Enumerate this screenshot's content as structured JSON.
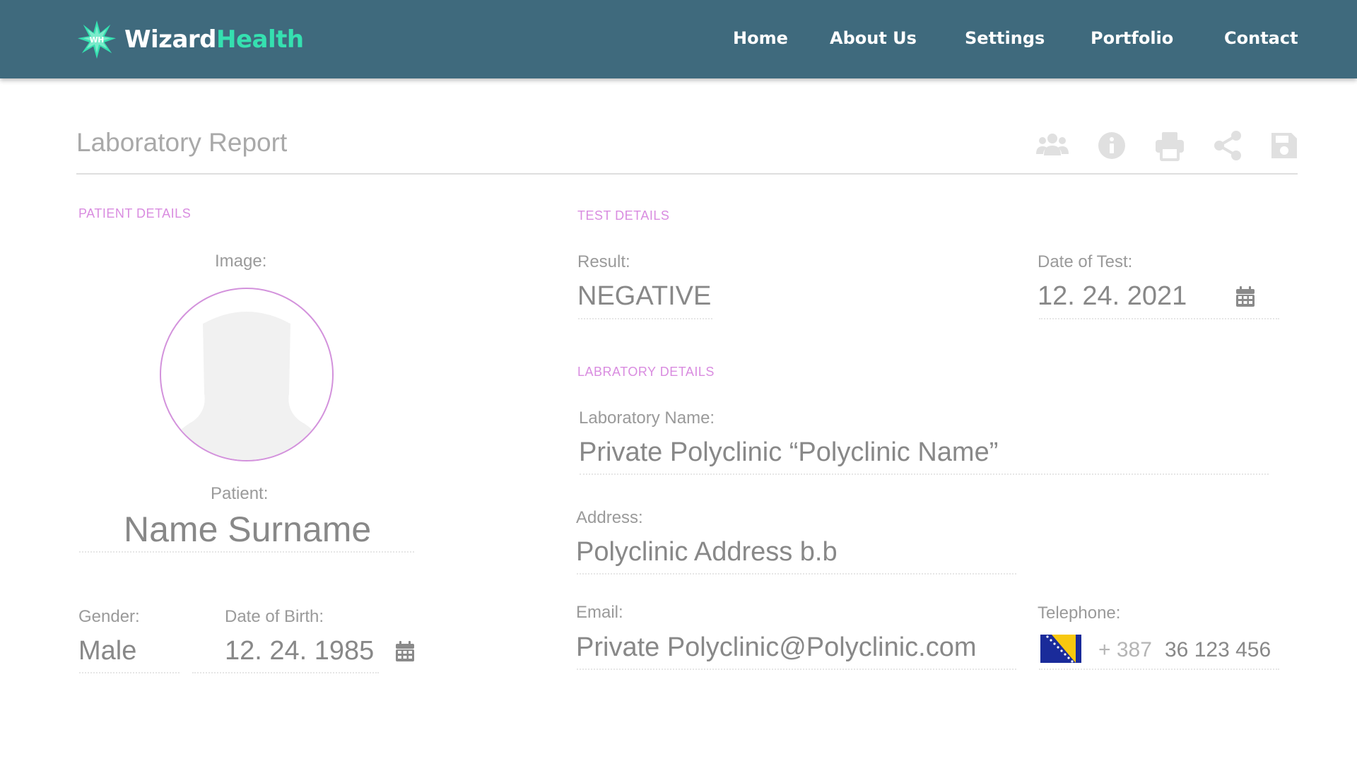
{
  "header": {
    "logo": {
      "word1": "Wizard",
      "word2": "Health",
      "mark_text": "WH",
      "accent_color": "#35e0b0",
      "bar_color": "#3f6a7d"
    },
    "nav": [
      {
        "label": "Home"
      },
      {
        "label": "About Us"
      },
      {
        "label": "Settings"
      },
      {
        "label": "Portfolio"
      },
      {
        "label": "Contact"
      }
    ]
  },
  "page": {
    "title": "Laboratory Report",
    "toolbar_icons": [
      "users-icon",
      "info-icon",
      "print-icon",
      "share-icon",
      "save-icon"
    ]
  },
  "patient": {
    "section_label": "PATIENT DETAILS",
    "image_label": "Image:",
    "patient_label": "Patient:",
    "name": "Name Surname",
    "gender_label": "Gender:",
    "gender": "Male",
    "dob_label": "Date of Birth:",
    "dob": "12. 24. 1985"
  },
  "test": {
    "section_label": "TEST DETAILS",
    "result_label": "Result:",
    "result": "NEGATIVE",
    "date_label": "Date of Test:",
    "date": "12. 24. 2021"
  },
  "laboratory": {
    "section_label": "LABRATORY DETAILS",
    "name_label": "Laboratory Name:",
    "name": "Private Polyclinic “Polyclinic Name”",
    "address_label": "Address:",
    "address": "Polyclinic Address b.b",
    "email_label": "Email:",
    "email": "Private Polyclinic@Polyclinic.com",
    "telephone_label": "Telephone:",
    "dial_code": "+ 387",
    "telephone": "36 123 456",
    "flag": "bosnia-herzegovina-flag"
  },
  "colors": {
    "section_label": "#d98ce0",
    "avatar_border": "#d392dc"
  }
}
